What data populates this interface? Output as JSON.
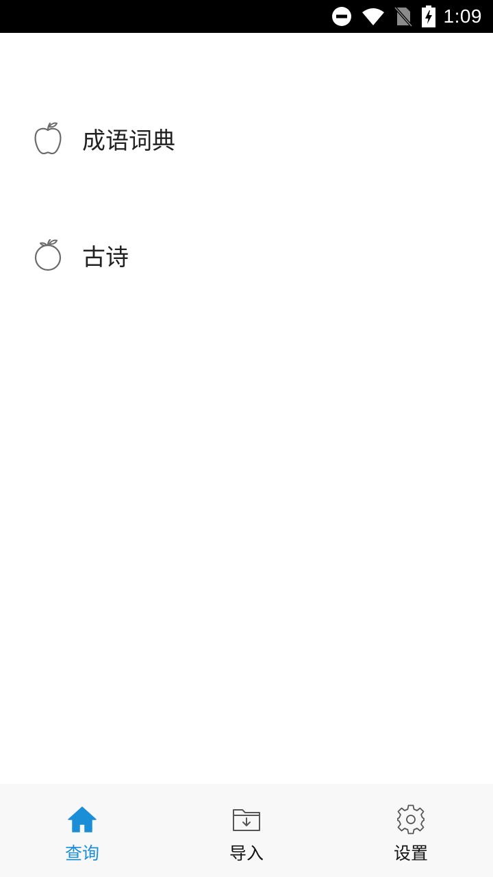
{
  "status_bar": {
    "time": "1:09",
    "icons": [
      "do-not-disturb-icon",
      "wifi-icon",
      "no-sim-icon",
      "battery-charging-icon"
    ]
  },
  "menu": {
    "items": [
      {
        "label": "成语词典",
        "icon": "apple-icon"
      },
      {
        "label": "古诗",
        "icon": "orange-fruit-icon"
      }
    ]
  },
  "bottom_nav": {
    "accent_color": "#1a8fd8",
    "tabs": [
      {
        "label": "查询",
        "icon": "home-icon",
        "active": true
      },
      {
        "label": "导入",
        "icon": "folder-import-icon",
        "active": false
      },
      {
        "label": "设置",
        "icon": "gear-icon",
        "active": false
      }
    ]
  }
}
